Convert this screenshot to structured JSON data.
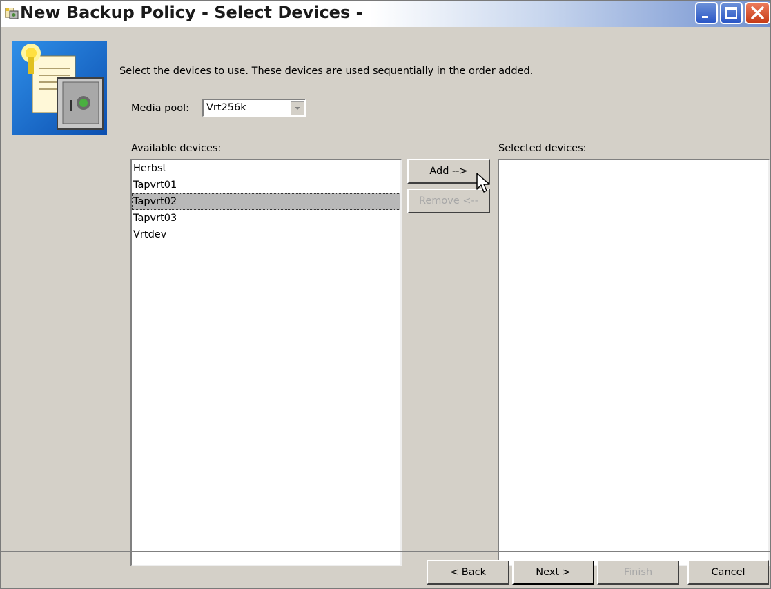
{
  "window": {
    "title": "New Backup Policy - Select Devices -"
  },
  "instruction": "Select the devices to use. These devices are used sequentially in the order added.",
  "media_pool": {
    "label": "Media pool:",
    "value": "Vrt256k"
  },
  "available": {
    "label": "Available devices:",
    "items": [
      "Herbst",
      "Tapvrt01",
      "Tapvrt02",
      "Tapvrt03",
      "Vrtdev"
    ],
    "selected_item": "Tapvrt02"
  },
  "selected": {
    "label": "Selected devices:",
    "items": []
  },
  "buttons": {
    "add": "Add -->",
    "remove": "Remove <--",
    "back": "< Back",
    "next": "Next >",
    "finish": "Finish",
    "cancel": "Cancel"
  },
  "colors": {
    "dialog_bg": "#d4d0c8",
    "selection_bg": "#b8b8b8",
    "disabled_text": "#a8a8a8"
  },
  "icons": [
    "window-app-icon",
    "minimize-icon",
    "maximize-icon",
    "close-icon",
    "wizard-safe-icon",
    "dropdown-arrow-icon",
    "mouse-cursor-icon"
  ]
}
